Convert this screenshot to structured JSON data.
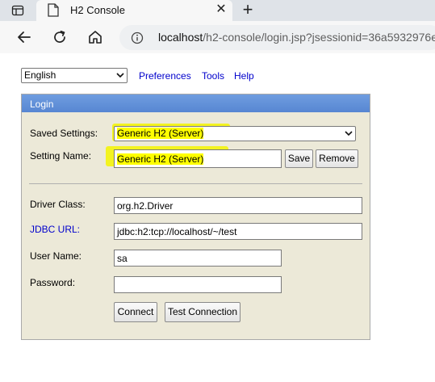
{
  "browser": {
    "tab_title": "H2 Console",
    "tab_close": "✕",
    "new_tab": "+",
    "url_host": "localhost",
    "url_path": "/h2-console/login.jsp?jsessionid=36a5932976e"
  },
  "page": {
    "language": "English",
    "links": {
      "preferences": "Preferences",
      "tools": "Tools",
      "help": "Help"
    },
    "login": {
      "header": "Login",
      "saved_settings_label": "Saved Settings:",
      "saved_settings_value": "Generic H2 (Server)",
      "setting_name_label": "Setting Name:",
      "setting_name_value": "Generic H2 (Server)",
      "save_button": "Save",
      "remove_button": "Remove",
      "driver_class_label": "Driver Class:",
      "driver_class_value": "org.h2.Driver",
      "jdbc_url_label": "JDBC URL:",
      "jdbc_url_value": "jdbc:h2:tcp://localhost/~/test",
      "user_name_label": "User Name:",
      "user_name_value": "sa",
      "password_label": "Password:",
      "password_value": "",
      "connect_button": "Connect",
      "test_connection_button": "Test Connection"
    }
  },
  "icons": {
    "window": "window-icon",
    "page": "page-icon",
    "back": "back-arrow-icon",
    "reload": "reload-icon",
    "home": "home-icon",
    "info": "info-icon",
    "dropdown": "chevron-down-icon"
  },
  "colors": {
    "panel_bg": "#ece9d8",
    "panel_header": "#5f8fd8",
    "link": "#0000cc",
    "highlight": "#ffff00"
  }
}
